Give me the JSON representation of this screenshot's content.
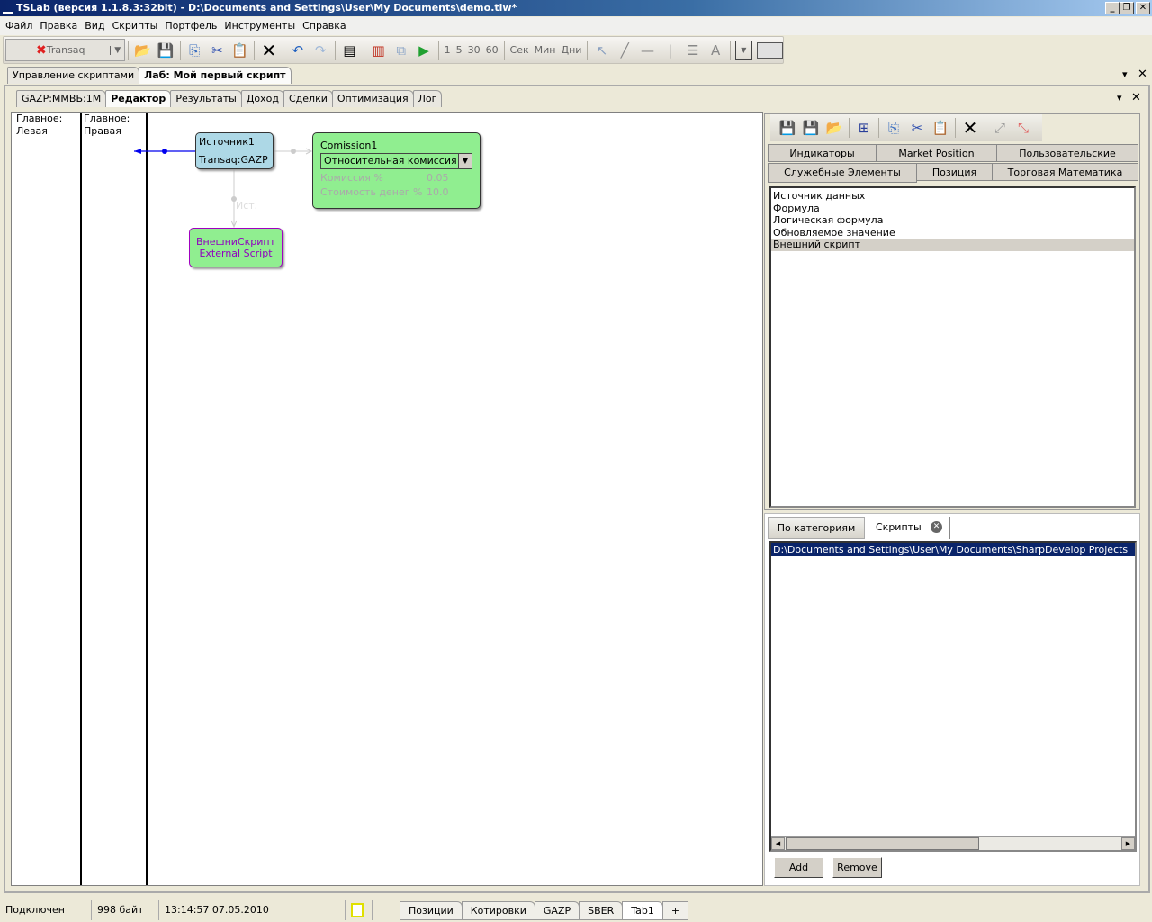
{
  "window": {
    "title": "TSLab (версия 1.1.8.3:32bit) - D:\\Documents and Settings\\User\\My Documents\\demo.tlw*",
    "minimize": "_",
    "restore": "❐",
    "close": "✕"
  },
  "menu": [
    "Файл",
    "Правка",
    "Вид",
    "Скрипты",
    "Портфель",
    "Инструменты",
    "Справка"
  ],
  "toolbar": {
    "connection": "Transaq",
    "intervals": [
      "1",
      "5",
      "30",
      "60"
    ],
    "units": [
      "Сек",
      "Мин",
      "Дни"
    ]
  },
  "doc_tabs": [
    "Управление скриптами",
    "Лаб: Мой первый скрипт"
  ],
  "inner_tabs": [
    "GAZP:ММВБ:1М",
    "Редактор",
    "Результаты",
    "Доход",
    "Сделки",
    "Оптимизация",
    "Лог"
  ],
  "editor": {
    "columns": [
      {
        "title": "Главное:",
        "sub": "Левая"
      },
      {
        "title": "Главное:",
        "sub": "Правая"
      }
    ],
    "source_node": {
      "name": "Источник1",
      "value": "Transaq:GAZP"
    },
    "commission_node": {
      "name": "Comission1",
      "type": "Относительная комиссия",
      "params": [
        {
          "label": "Комиссия %",
          "value": "0.05"
        },
        {
          "label": "Стоимость денег %",
          "value": "10.0"
        }
      ]
    },
    "edge_label": "Ист.",
    "script_node": {
      "line1": "ВнешниСкрипт",
      "line2": "External Script"
    }
  },
  "palette": {
    "tabs_row1": [
      "Индикаторы",
      "Market Position",
      "Пользовательские"
    ],
    "tabs_row2": [
      "Служебные Элементы",
      "Позиция",
      "Торговая Математика"
    ],
    "items": [
      "Источник данных",
      "Формула",
      "Логическая формула",
      "Обновляемое значение",
      "Внешний скрипт"
    ],
    "selected_index": 4
  },
  "scripts_panel": {
    "tabs": [
      "По категориям",
      "Скрипты"
    ],
    "items": [
      "D:\\Documents and Settings\\User\\My Documents\\SharpDevelop Projects"
    ],
    "add": "Add",
    "remove": "Remove"
  },
  "status": {
    "connection": "Подключен",
    "size": "998 байт",
    "datetime": "13:14:57 07.05.2010",
    "tabs": [
      "Позиции",
      "Котировки",
      "GAZP",
      "SBER",
      "Tab1"
    ],
    "add_tab": "+"
  }
}
